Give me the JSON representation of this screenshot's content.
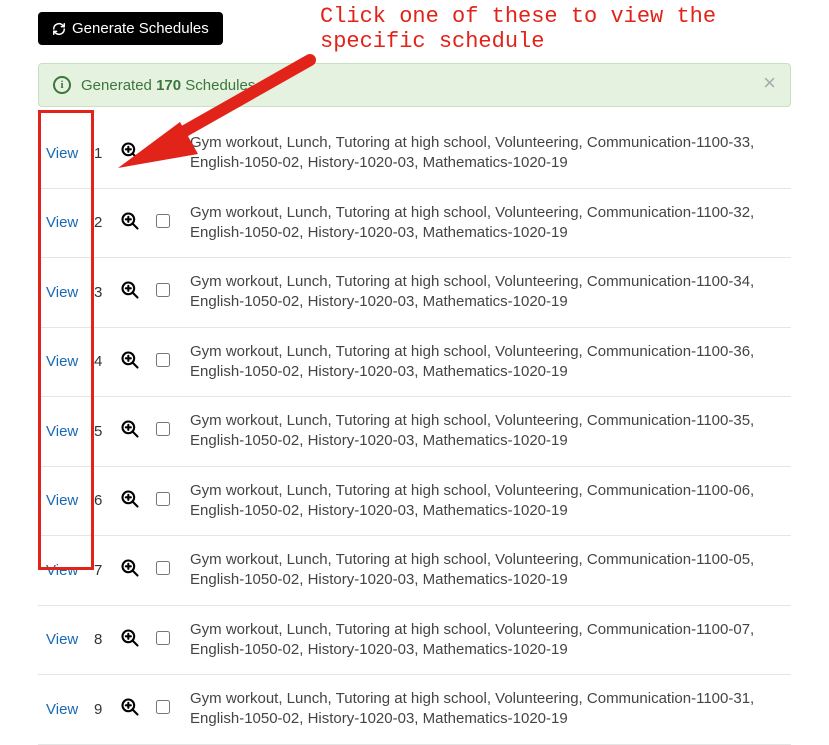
{
  "generate_button_label": "Generate Schedules",
  "alert": {
    "prefix": "Generated ",
    "count": "170",
    "suffix": " Schedules."
  },
  "view_label": "View",
  "rows": [
    {
      "num": "1",
      "desc": "Gym workout, Lunch, Tutoring at high school, Volunteering, Communication-1100-33, English-1050-02, History-1020-03, Mathematics-1020-19"
    },
    {
      "num": "2",
      "desc": "Gym workout, Lunch, Tutoring at high school, Volunteering, Communication-1100-32, English-1050-02, History-1020-03, Mathematics-1020-19"
    },
    {
      "num": "3",
      "desc": "Gym workout, Lunch, Tutoring at high school, Volunteering, Communication-1100-34, English-1050-02, History-1020-03, Mathematics-1020-19"
    },
    {
      "num": "4",
      "desc": "Gym workout, Lunch, Tutoring at high school, Volunteering, Communication-1100-36, English-1050-02, History-1020-03, Mathematics-1020-19"
    },
    {
      "num": "5",
      "desc": "Gym workout, Lunch, Tutoring at high school, Volunteering, Communication-1100-35, English-1050-02, History-1020-03, Mathematics-1020-19"
    },
    {
      "num": "6",
      "desc": "Gym workout, Lunch, Tutoring at high school, Volunteering, Communication-1100-06, English-1050-02, History-1020-03, Mathematics-1020-19"
    },
    {
      "num": "7",
      "desc": "Gym workout, Lunch, Tutoring at high school, Volunteering, Communication-1100-05, English-1050-02, History-1020-03, Mathematics-1020-19"
    },
    {
      "num": "8",
      "desc": "Gym workout, Lunch, Tutoring at high school, Volunteering, Communication-1100-07, English-1050-02, History-1020-03, Mathematics-1020-19"
    },
    {
      "num": "9",
      "desc": "Gym workout, Lunch, Tutoring at high school, Volunteering, Communication-1100-31, English-1050-02, History-1020-03, Mathematics-1020-19"
    }
  ],
  "annotation_text": "Click one of these to view the specific schedule"
}
